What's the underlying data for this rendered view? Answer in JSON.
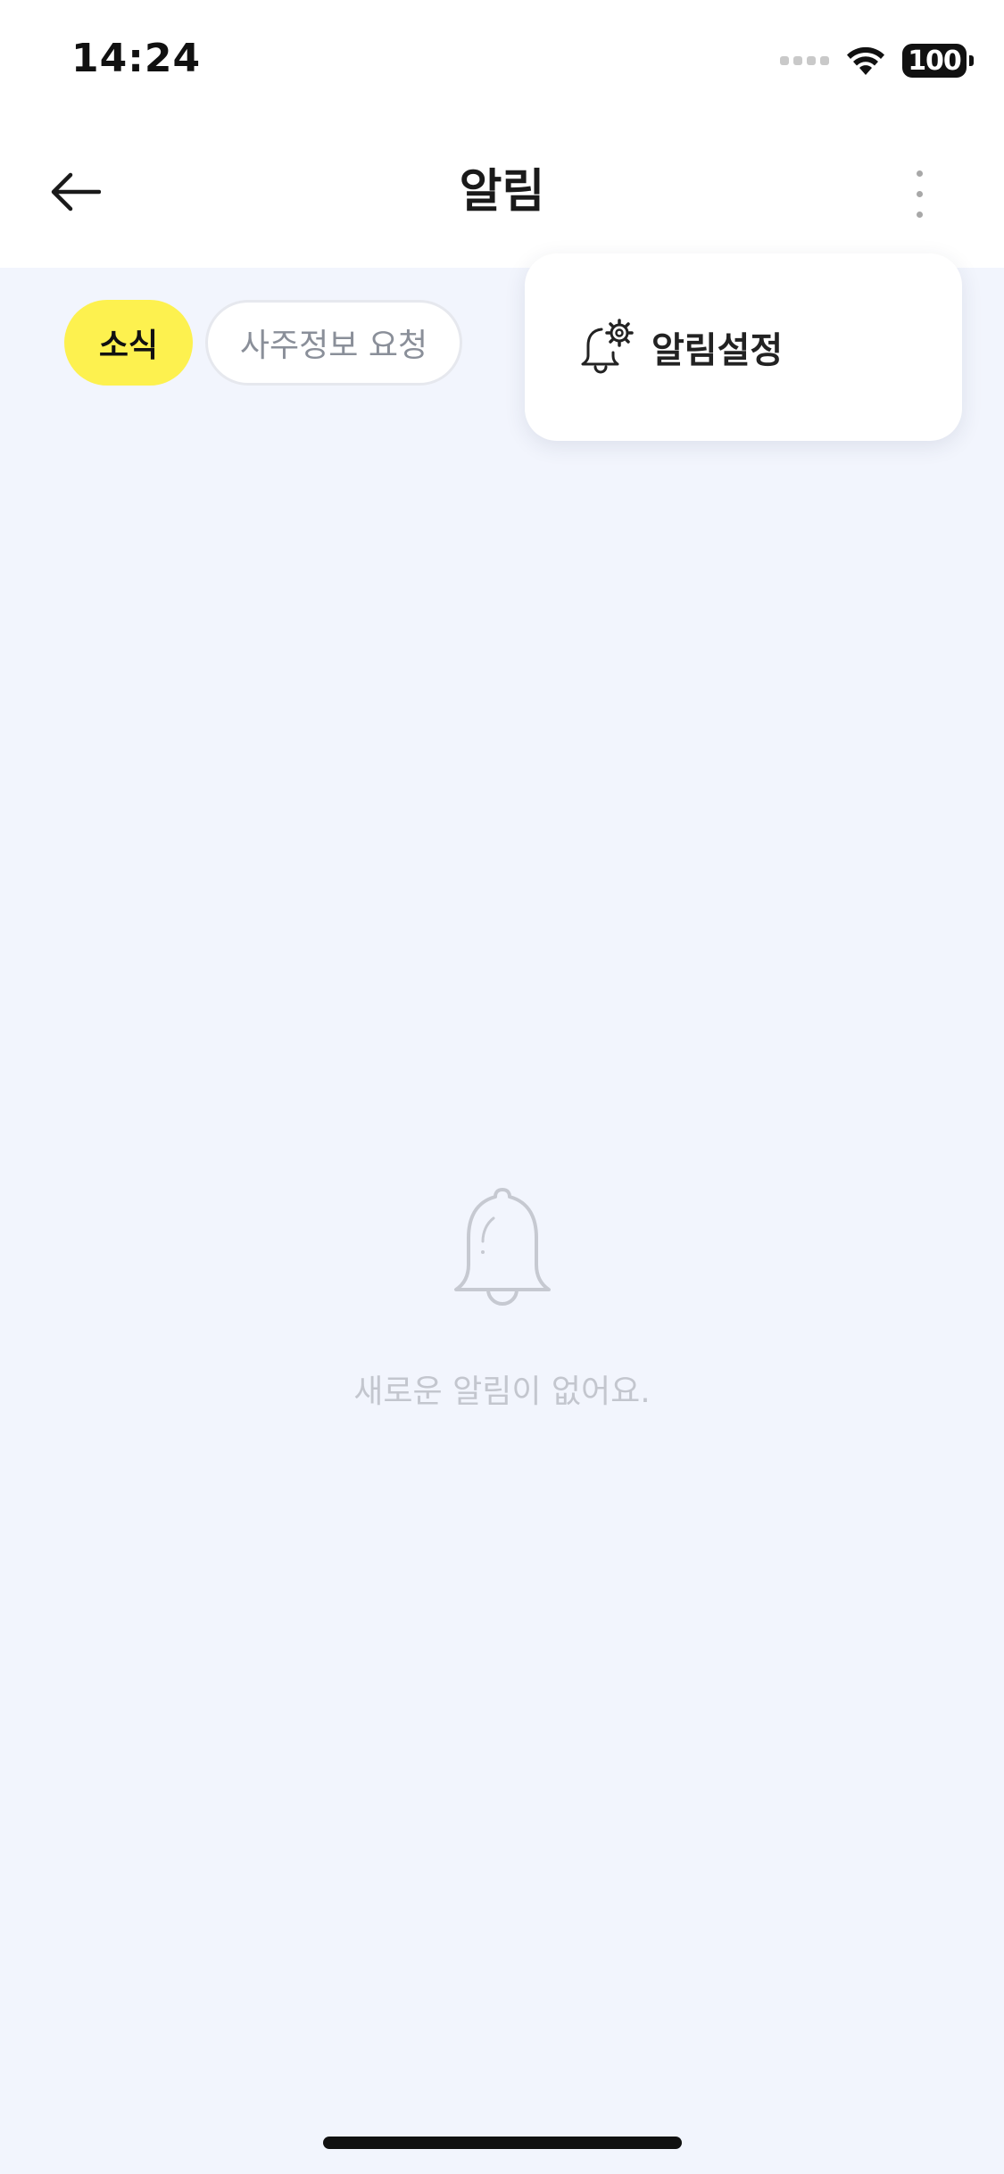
{
  "status_bar": {
    "time": "14:24",
    "battery": "100",
    "wifi_icon": "wifi-icon",
    "signal_icon": "cellular-signal-icon"
  },
  "header": {
    "title": "알림",
    "back_icon": "arrow-left-icon",
    "more_icon": "more-vertical-icon"
  },
  "tabs": [
    {
      "label": "소식",
      "active": true
    },
    {
      "label": "사주정보 요청",
      "active": false
    }
  ],
  "menu": {
    "items": [
      {
        "label": "알림설정",
        "icon": "bell-settings-icon"
      }
    ]
  },
  "empty_state": {
    "icon": "bell-icon",
    "message": "새로운 알림이 없어요."
  },
  "colors": {
    "background": "#f2f5fd",
    "active_tab": "#fdf14f",
    "inactive_tab_text": "#8a8f99",
    "empty_text": "#c3c6ce"
  }
}
